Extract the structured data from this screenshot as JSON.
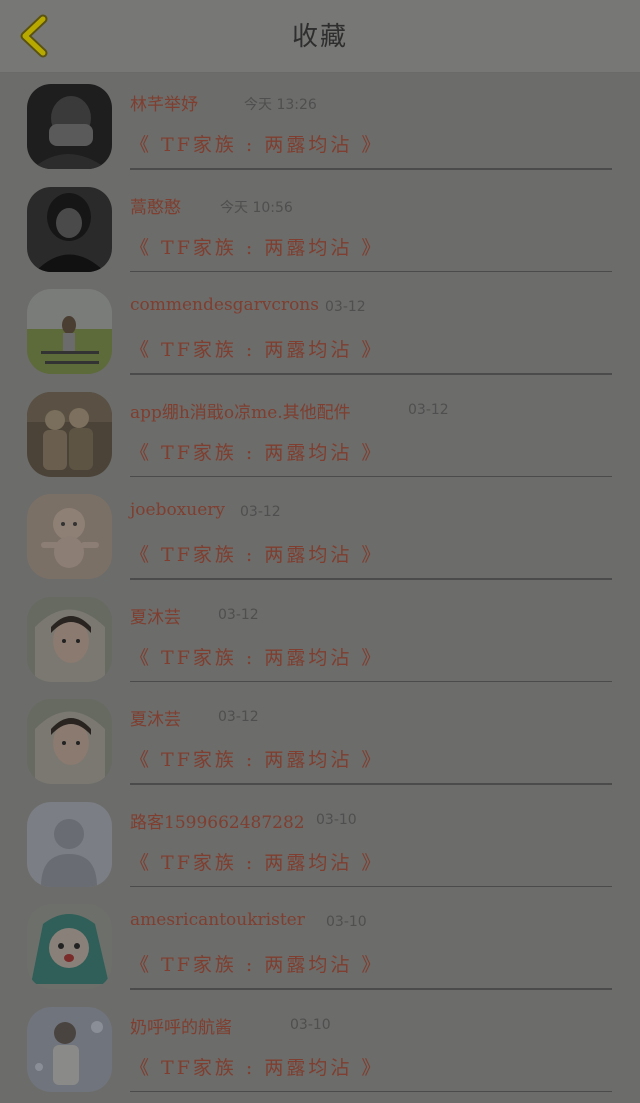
{
  "header": {
    "title": "收藏",
    "back_icon": "chevron-left-icon",
    "accent": "#ffd400"
  },
  "favorites": [
    {
      "name": "林芊举妤",
      "time": "今天 13:26",
      "book": "《 TF家族 : 两露均沾 》",
      "avatar": "avatar-dark-portrait"
    },
    {
      "name": "蒿憨憨",
      "time": "今天 10:56",
      "book": "《 TF家族 : 两露均沾 》",
      "avatar": "avatar-dark-hair"
    },
    {
      "name": "commendesgarvcrons",
      "time": "03-12",
      "book": "《 TF家族 : 两露均沾 》",
      "avatar": "avatar-outdoor-scene"
    },
    {
      "name": "app绷h消戢o凉me.其他配件",
      "time": "03-12",
      "book": "《 TF家族 : 两露均沾 》",
      "avatar": "avatar-vintage-children"
    },
    {
      "name": "joeboxuery",
      "time": "03-12",
      "book": "《 TF家族 : 两露均沾 》",
      "avatar": "avatar-kewpie-doll"
    },
    {
      "name": "夏沐芸",
      "time": "03-12",
      "book": "《 TF家族 : 两露均沾 》",
      "avatar": "avatar-girl-hood"
    },
    {
      "name": "夏沐芸",
      "time": "03-12",
      "book": "《 TF家族 : 两露均沾 》",
      "avatar": "avatar-girl-hood"
    },
    {
      "name": "路客1599662487282",
      "time": "03-10",
      "book": "《 TF家族 : 两露均沾 》",
      "avatar": "avatar-default-silhouette"
    },
    {
      "name": "amesricantoukrister",
      "time": "03-10",
      "book": "《 TF家族 : 两露均沾 》",
      "avatar": "avatar-anime-miku"
    },
    {
      "name": "奶呼呼的航酱",
      "time": "03-10",
      "book": "《 TF家族 : 两露均沾 》",
      "avatar": "avatar-stage-performer"
    }
  ]
}
